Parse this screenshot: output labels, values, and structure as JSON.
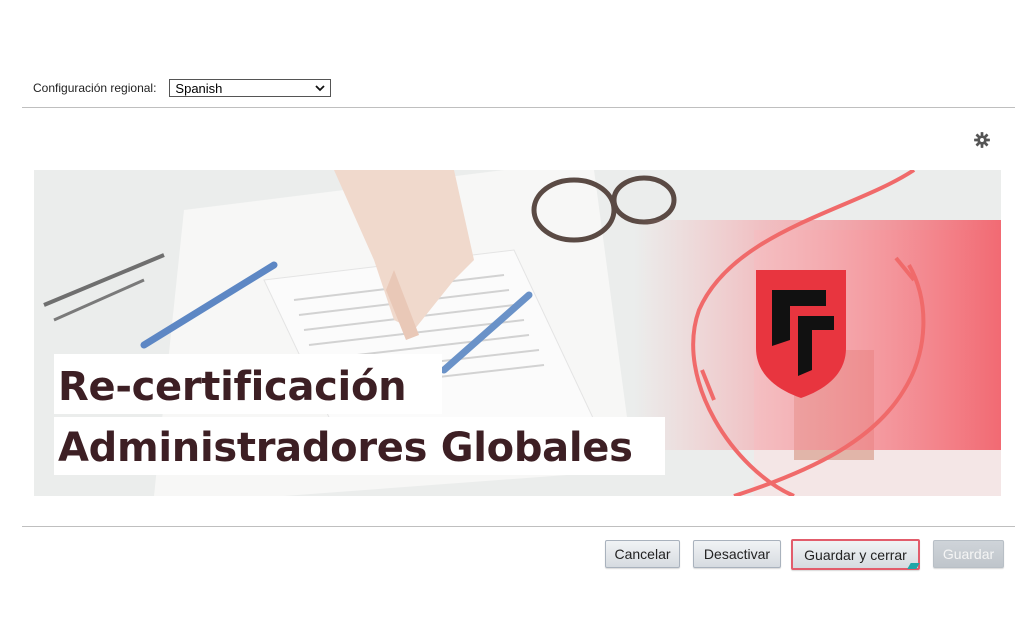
{
  "locale": {
    "label": "Configuración regional:",
    "selected": "Spanish"
  },
  "toolbar": {
    "settings_icon": "gear-icon"
  },
  "banner": {
    "title_line1": "Re-certificación",
    "title_line2": "Administradores Globales",
    "logo_letters": "CF",
    "accent_color": "#f26b6b",
    "title_color": "#3d1f24",
    "shield_color": "#e8353f"
  },
  "actions": {
    "cancel": "Cancelar",
    "deactivate": "Desactivar",
    "save_close": "Guardar y cerrar",
    "save": "Guardar"
  }
}
